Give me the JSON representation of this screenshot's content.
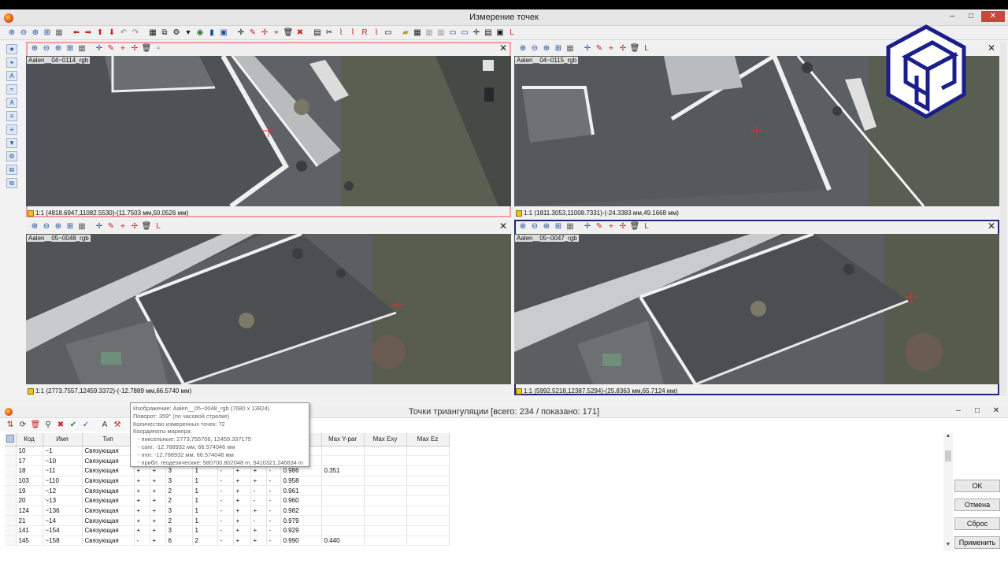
{
  "window": {
    "title": "Измерение точек"
  },
  "panes": [
    {
      "filename": "Aalen__04~0114_rgb",
      "coords": "1:1 (4818.6947,11082.5530)-(11.7503 мм,50.0526 мм)"
    },
    {
      "filename": "Aalen__04~0115_rgb",
      "coords": "1:1 (1811.3053,11008.7331)-(-24.3383 мм,49.1668 мм)"
    },
    {
      "filename": "Aalen__05~0048_rgb",
      "coords": "1:1 (2773.7557,12459.3372)-(-12.7889 мм,66.5740 мм)"
    },
    {
      "filename": "Aalen__05~0047_rgb",
      "coords": "1:1 (5992.5218,12387.5294)-(25.8363 мм,65.7124 мм)"
    }
  ],
  "tooltip": {
    "lines": [
      "Изображение: Aalen__05~0048_rgb (7680 x 13824)",
      "Поворот: 359° (по часовой стрелке)",
      "Количество измеренных точек: 72",
      "Координаты маркера:",
      "  - пиксельные: 2773.755706, 12459.337175",
      "  - cam: -12.788932 мм, 66.574046 мм",
      "  - mm: -12.788932 мм, 66.574046 мм",
      "  - прибл. геодезические: 580700.802048 m, 5410321.246634 m"
    ]
  },
  "bottom": {
    "title": "Точки триангуляции [всего: 234 / показано: 171]",
    "columns": [
      "Код",
      "Имя",
      "Тип",
      "",
      "",
      "",
      "",
      "",
      "",
      "",
      "",
      "R...",
      "Max Y-par",
      "Max Exy",
      "Max Ez"
    ],
    "rows": [
      [
        "10",
        "~1",
        "Связующая",
        "",
        "",
        "",
        "",
        "",
        "",
        "",
        "",
        "0.972",
        "",
        "",
        ""
      ],
      [
        "17",
        "~10",
        "Связующая",
        "",
        "",
        "",
        "",
        "",
        "",
        "",
        "",
        "0.969",
        "",
        "",
        ""
      ],
      [
        "18",
        "~11",
        "Связующая",
        "+",
        "+",
        "3",
        "1",
        "-",
        "+",
        "+",
        "-",
        "0.986",
        "0.351",
        "",
        ""
      ],
      [
        "103",
        "~110",
        "Связующая",
        "+",
        "+",
        "3",
        "1",
        "-",
        "+",
        "+",
        "-",
        "0.958",
        "",
        "",
        ""
      ],
      [
        "19",
        "~12",
        "Связующая",
        "+",
        "+",
        "2",
        "1",
        "-",
        "+",
        "-",
        "-",
        "0.961",
        "",
        "",
        ""
      ],
      [
        "20",
        "~13",
        "Связующая",
        "+",
        "+",
        "2",
        "1",
        "-",
        "+",
        "-",
        "-",
        "0.960",
        "",
        "",
        ""
      ],
      [
        "124",
        "~136",
        "Связующая",
        "+",
        "+",
        "3",
        "1",
        "-",
        "+",
        "+",
        "-",
        "0.982",
        "",
        "",
        ""
      ],
      [
        "21",
        "~14",
        "Связующая",
        "+",
        "+",
        "2",
        "1",
        "-",
        "+",
        "-",
        "-",
        "0.979",
        "",
        "",
        ""
      ],
      [
        "141",
        "~154",
        "Связующая",
        "+",
        "+",
        "3",
        "1",
        "-",
        "+",
        "+",
        "-",
        "0.929",
        "",
        "",
        ""
      ],
      [
        "145",
        "~158",
        "Связующая",
        "-",
        "+",
        "6",
        "2",
        "-",
        "+",
        "+",
        "-",
        "0.990",
        "0.440",
        "",
        ""
      ]
    ],
    "buttons": {
      "ok": "OK",
      "cancel": "Отмена",
      "reset": "Сброс",
      "apply": "Применить"
    }
  },
  "colors": {
    "selected_pane_red": "#f0a0a0",
    "selected_pane_blue": "#1d2a6b",
    "marker": "#e0302a"
  }
}
